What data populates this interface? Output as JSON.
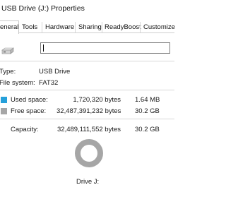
{
  "window": {
    "title": "USB Drive (J:) Properties"
  },
  "tabs": [
    {
      "label": "eneral",
      "active": true
    },
    {
      "label": "Tools",
      "active": false
    },
    {
      "label": "Hardware",
      "active": false
    },
    {
      "label": "Sharing",
      "active": false
    },
    {
      "label": "ReadyBoost",
      "active": false
    },
    {
      "label": "Customize",
      "active": false
    }
  ],
  "general": {
    "name_value": "",
    "type_label": "Type:",
    "type_value": "USB Drive",
    "fs_label": "File system:",
    "fs_value": "FAT32",
    "used_label": "Used space:",
    "used_bytes": "1,720,320 bytes",
    "used_human": "1.64 MB",
    "free_label": "Free space:",
    "free_bytes": "32,487,391,232 bytes",
    "free_human": "30.2 GB",
    "capacity_label": "Capacity:",
    "capacity_bytes": "32,489,111,552 bytes",
    "capacity_human": "30.2 GB",
    "drive_caption": "Drive J:",
    "used_fraction": 5.3e-05,
    "used_color": "#26a0da",
    "free_color": "#a6a6a6",
    "drive_icon": "usb-drive-icon"
  }
}
